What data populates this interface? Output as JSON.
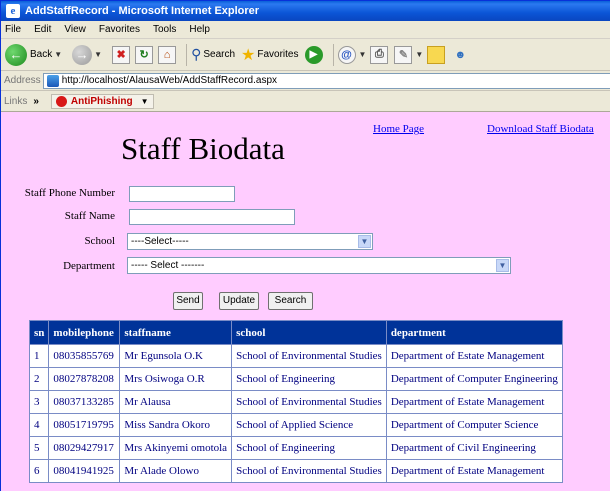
{
  "window": {
    "title": "AddStaffRecord - Microsoft Internet Explorer"
  },
  "menu": [
    "File",
    "Edit",
    "View",
    "Favorites",
    "Tools",
    "Help"
  ],
  "toolbar": {
    "back_label": "Back",
    "search_label": "Search",
    "favorites_label": "Favorites"
  },
  "address": {
    "label": "Address",
    "url": "http://localhost/AlausaWeb/AddStaffRecord.aspx"
  },
  "links": {
    "label": "Links",
    "chevron": "»",
    "antiphishing_label": "AntiPhishing"
  },
  "page": {
    "title": "Staff Biodata",
    "home_link": "Home Page",
    "download_link": "Download Staff Biodata",
    "form": {
      "phone_label": "Staff Phone Number",
      "phone_value": "",
      "name_label": "Staff Name",
      "name_value": "",
      "school_label": "School",
      "school_selected": "----Select-----",
      "department_label": "Department",
      "department_selected": "----- Select -------"
    },
    "buttons": {
      "send": "Send",
      "update": "Update",
      "search": "Search"
    },
    "table": {
      "headers": [
        "sn",
        "mobilephone",
        "staffname",
        "school",
        "department"
      ],
      "rows": [
        [
          "1",
          "08035855769",
          "Mr Egunsola O.K",
          "School of Environmental Studies",
          "Department of Estate Management"
        ],
        [
          "2",
          "08027878208",
          "Mrs Osiwoga O.R",
          "School of Engineering",
          "Department of Computer Engineering"
        ],
        [
          "3",
          "08037133285",
          "Mr Alausa",
          "School of Environmental Studies",
          "Department of Estate Management"
        ],
        [
          "4",
          "08051719795",
          "Miss Sandra Okoro",
          "School of Applied Science",
          "Department of Computer Science"
        ],
        [
          "5",
          "08029427917",
          "Mrs Akinyemi omotola",
          "School of Engineering",
          "Department of Civil Engineering"
        ],
        [
          "6",
          "08041941925",
          "Mr Alade Olowo",
          "School of Environmental Studies",
          "Department of Estate Management"
        ]
      ]
    }
  },
  "icons": [
    "ie-icon",
    "back-arrow-icon",
    "forward-arrow-icon",
    "stop-icon",
    "refresh-icon",
    "home-icon",
    "search-icon",
    "favorites-star-icon",
    "media-icon",
    "mail-icon",
    "print-icon",
    "edit-icon",
    "folder-icon",
    "messenger-icon",
    "page-icon",
    "antiphishing-icon"
  ],
  "colors": {
    "page_background": "#ffccff",
    "table_header": "#003399",
    "table_text": "#000080",
    "title_bar": "#0a46c0"
  }
}
